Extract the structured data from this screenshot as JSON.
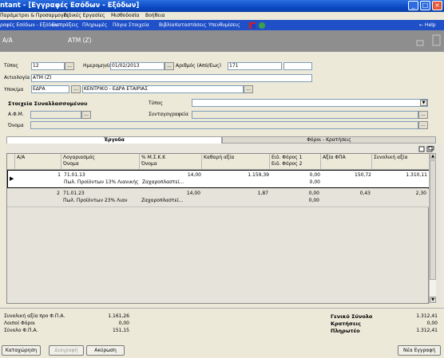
{
  "window": {
    "title": "ntant - [Εγγραφές Εσόδων - Εξόδων]",
    "controls": [
      "_",
      "□",
      "×"
    ]
  },
  "menubar1": [
    "Παράμετροι & Προσαρμογές",
    "Ειδικές Εργασίες",
    "Μισθοδοσία",
    "Βοήθεια"
  ],
  "menubar2": {
    "items": [
      "ραφές Εσόδων - Εξόδων",
      "Εισπράξεις",
      "Πληρωμές",
      "Πάγια Στοιχεία",
      "Βιβλία",
      "Καταστάσεις",
      "Υπενθυμίσεις"
    ],
    "help": "← Help"
  },
  "header": {
    "aa_label": "Α/Α",
    "type_value": "ΑΤΜ (Ζ)"
  },
  "form": {
    "type_label": "Τύπος",
    "type_value": "12",
    "date_label": "Ημερομηνία",
    "date_value": "01/02/2013",
    "number_label": "Αριθμός (Από/Εως)",
    "number_from": "171",
    "number_to": "",
    "cause_label": "Αιτιολογία",
    "cause_value": "ΑΤΜ (Ζ)",
    "branch_label": "Υποκ/μα",
    "branch_code": "ΕΔΡΑ",
    "branch_name": "ΚΕΝΤΡΙΚΟ - ΕΔΡΑ ΕΤΑΙΡΙΑΣ",
    "counterparty_title": "Στοιχεία Συναλλασσομένου",
    "kind_label": "Τύπος",
    "kind_value": "",
    "afm_label": "Α.Φ.Μ.",
    "afm_value": "",
    "linkage_label": "Συνταγογραφεία",
    "linkage_value": "",
    "name_label": "Όνομα",
    "name_value": ""
  },
  "tabs": [
    "Έργοδα",
    "Φόροι - Κρατήσεις"
  ],
  "grid": {
    "headers": [
      {
        "top": "Α/Α",
        "bottom": ""
      },
      {
        "top": "Λογαριασμός",
        "bottom": "Όνομα"
      },
      {
        "top": "% Μ.Σ.Κ.Κ",
        "bottom": "Όνομα"
      },
      {
        "top": "Καθαρή αξία",
        "bottom": ""
      },
      {
        "top": "Ειδ. Φόρος 1",
        "bottom": "Ειδ. Φόρος 2"
      },
      {
        "top": "Αξία ΦΠΑ",
        "bottom": ""
      },
      {
        "top": "Συνολική αξία",
        "bottom": ""
      }
    ],
    "rows": [
      {
        "aa": "1",
        "account": "71.01.13",
        "account_name": "Πωλ. Προϊόντων 13% Λιανικής",
        "pct": "14,00",
        "pct_name": "Ζαχαροπλαστεί...",
        "net": "1.159,39",
        "tax1": "0,00",
        "tax2": "0,00",
        "vat": "150,72",
        "total": "1.310,11"
      },
      {
        "aa": "2",
        "account": "71.01.23",
        "account_name": "Πωλ. Προϊόντων 23% Λιαν",
        "pct": "14,00",
        "pct_name": "Ζαχαροπλαστεί...",
        "net": "1,87",
        "tax1": "0,00",
        "tax2": "0,00",
        "vat": "0,43",
        "total": "2,30"
      }
    ]
  },
  "totals": {
    "net_label": "Συνολική αξία προ Φ.Π.Α.",
    "net_value": "1.161,26",
    "other_label": "Λοιποί Φόροι",
    "other_value": "0,00",
    "vat_label": "Σύνολο Φ.Π.Α.",
    "vat_value": "151,15",
    "grand_label": "Γενικό Σύνολο",
    "grand_value": "1.312,41",
    "ret_label": "Κρατήσεις",
    "ret_value": "0,00",
    "pay_label": "Πληρωτέο",
    "pay_value": "1.312,41"
  },
  "buttons": {
    "save": "Καταχώρηση",
    "delete": "Διαγραφή",
    "cancel": "Ακύρωση",
    "new": "Νέα Εγγραφή"
  }
}
